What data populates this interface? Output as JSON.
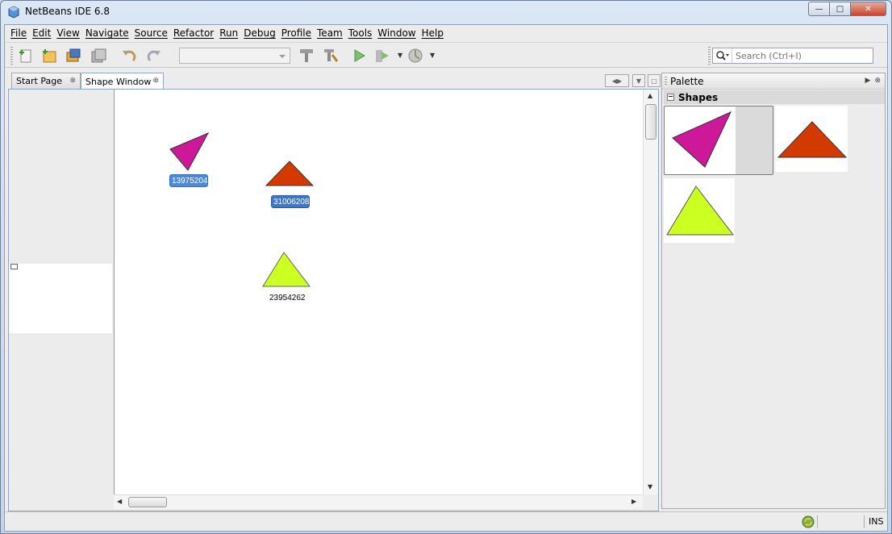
{
  "window": {
    "title": "NetBeans IDE 6.8"
  },
  "menu": {
    "items": [
      "File",
      "Edit",
      "View",
      "Navigate",
      "Source",
      "Refactor",
      "Run",
      "Debug",
      "Profile",
      "Team",
      "Tools",
      "Window",
      "Help"
    ]
  },
  "toolbar": {
    "buttons": [
      "new-file-icon",
      "new-project-icon",
      "open-project-icon",
      "save-all-icon",
      "undo-icon",
      "redo-icon",
      "build-icon",
      "clean-build-icon",
      "run-icon",
      "debug-icon",
      "profile-icon"
    ],
    "config_value": "",
    "search_placeholder": "Search (Ctrl+I)"
  },
  "editor": {
    "tabs": [
      {
        "label": "Start Page",
        "active": false
      },
      {
        "label": "Shape Window",
        "active": true
      }
    ],
    "shapes": [
      {
        "kind": "triangle",
        "color": "#cc1899",
        "label": "13975204",
        "selected": true
      },
      {
        "kind": "triangle",
        "color": "#d33a00",
        "label": "31006208",
        "selected": true
      },
      {
        "kind": "triangle",
        "color": "#ccff22",
        "label": "23954262",
        "selected": false
      }
    ]
  },
  "palette": {
    "title": "Palette",
    "category": "Shapes",
    "items": [
      {
        "icon": "magenta-triangle-icon",
        "color": "#cc1899",
        "selected": true
      },
      {
        "icon": "red-triangle-icon",
        "color": "#d33a00",
        "selected": false
      },
      {
        "icon": "lime-triangle-icon",
        "color": "#ccff22",
        "selected": false
      }
    ]
  },
  "status": {
    "mode": "INS"
  }
}
